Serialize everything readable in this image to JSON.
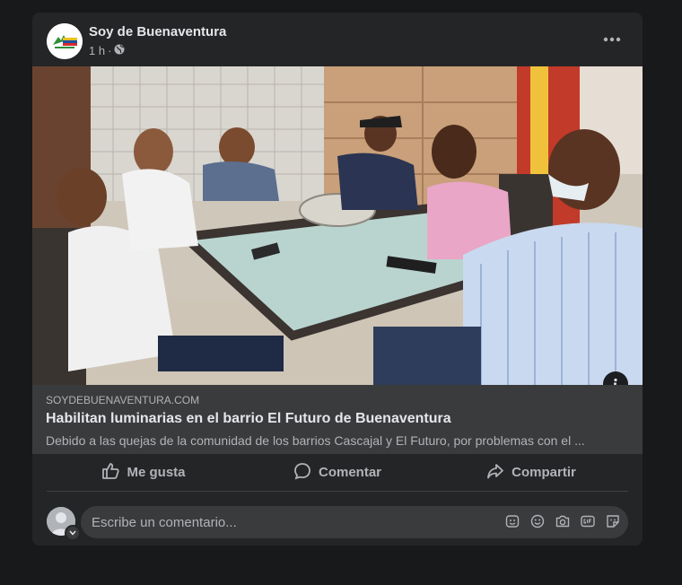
{
  "post": {
    "page_name": "Soy de Buenaventura",
    "time": "1 h",
    "separator": "·",
    "privacy_icon": "globe-icon",
    "more_icon": "more-options-icon"
  },
  "link": {
    "domain": "SOYDEBUENAVENTURA.COM",
    "title": "Habilitan luminarias en el barrio El Futuro de Buenaventura",
    "description": "Debido a las quejas de la comunidad de los barrios Cascajal y El Futuro, por problemas con el ..."
  },
  "actions": {
    "like": "Me gusta",
    "comment": "Comentar",
    "share": "Compartir"
  },
  "comment_box": {
    "placeholder": "Escribe un comentario...",
    "icons": [
      "avatar-sticker-icon",
      "emoji-icon",
      "camera-icon",
      "gif-icon",
      "sticker-icon"
    ]
  },
  "colors": {
    "background": "#18191a",
    "card": "#242526",
    "link_box": "#3a3b3c",
    "primary_text": "#e4e6eb",
    "secondary_text": "#b0b3b8"
  }
}
